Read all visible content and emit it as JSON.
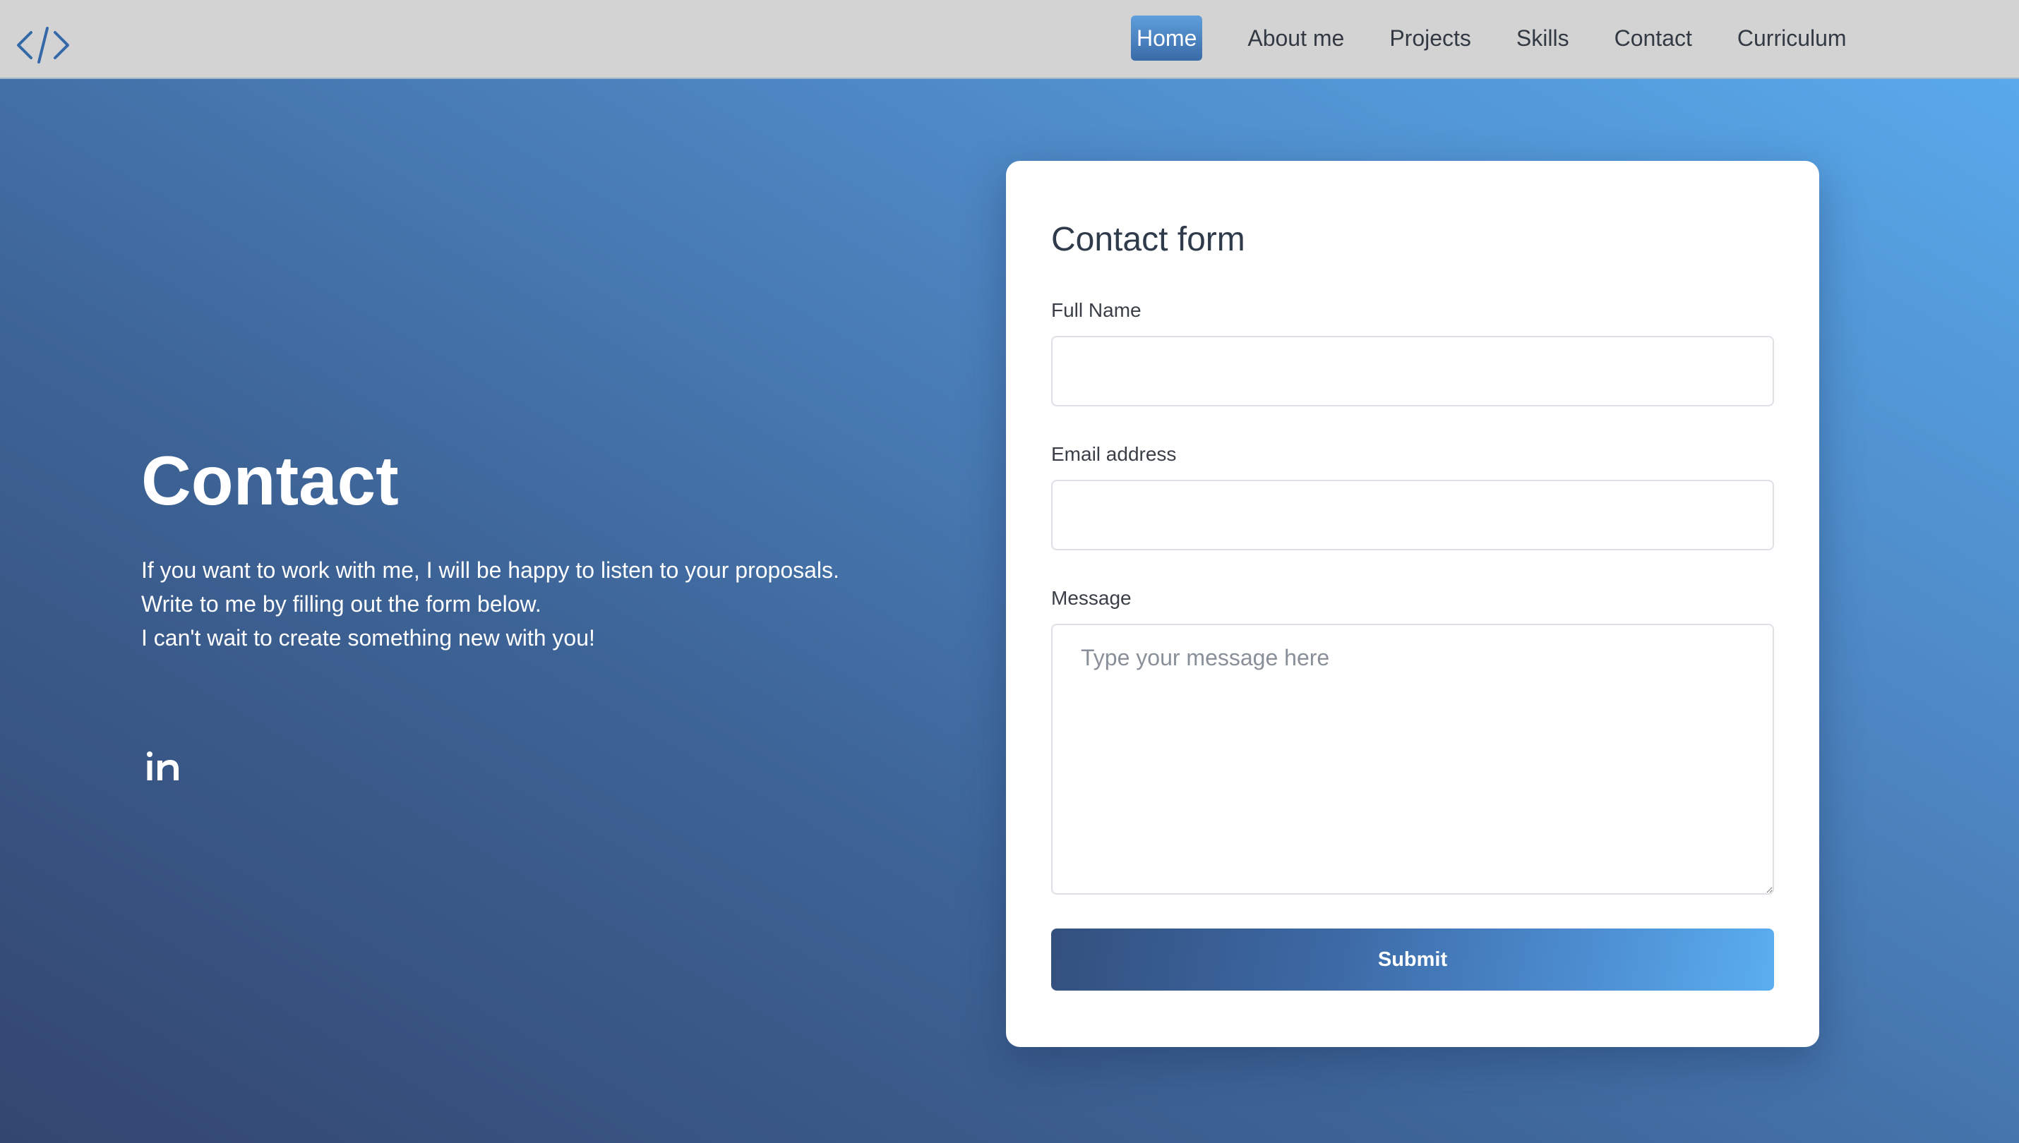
{
  "nav": {
    "logo_icon": "code-brackets-icon",
    "items": [
      {
        "label": "Home",
        "active": true
      },
      {
        "label": "About me",
        "active": false
      },
      {
        "label": "Projects",
        "active": false
      },
      {
        "label": "Skills",
        "active": false
      },
      {
        "label": "Contact",
        "active": false
      },
      {
        "label": "Curriculum",
        "active": false
      }
    ]
  },
  "hero": {
    "title": "Contact",
    "lines": [
      "If you want to work with me, I will be happy to listen to your proposals.",
      "Write to me by filling out the form below.",
      "I can't wait to create something new with you!"
    ],
    "social_icon": "linkedin-icon"
  },
  "form": {
    "title": "Contact form",
    "full_name_label": "Full Name",
    "full_name_value": "",
    "email_label": "Email address",
    "email_value": "",
    "message_label": "Message",
    "message_placeholder": "Type your message here",
    "submit_label": "Submit"
  },
  "colors": {
    "accent": "#3d6aa6",
    "nav_bg": "#d3d3d3",
    "gradient_dark": "#33466f",
    "gradient_light": "#5aadf0"
  }
}
